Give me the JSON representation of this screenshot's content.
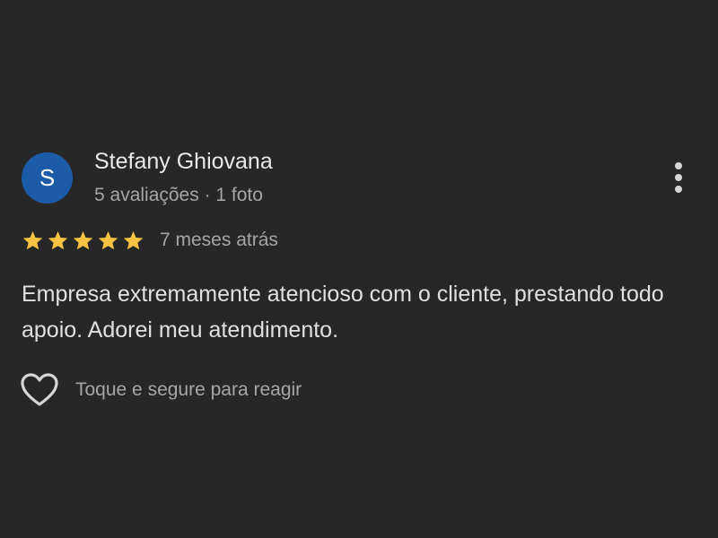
{
  "review": {
    "avatar_initial": "S",
    "avatar_color": "#1b5ba8",
    "reviewer_name": "Stefany Ghiovana",
    "reviewer_meta": "5 avaliações · 1 foto",
    "rating": 5,
    "rating_max": 5,
    "star_color": "#f6c342",
    "time_ago": "7 meses atrás",
    "text": "Empresa extremamente atencioso com o cliente, prestando todo apoio. Adorei meu atendimento.",
    "react_label": "Toque e segure para reagir",
    "more_menu_icon": "more-vert-icon",
    "react_icon": "heart-outline-icon"
  }
}
